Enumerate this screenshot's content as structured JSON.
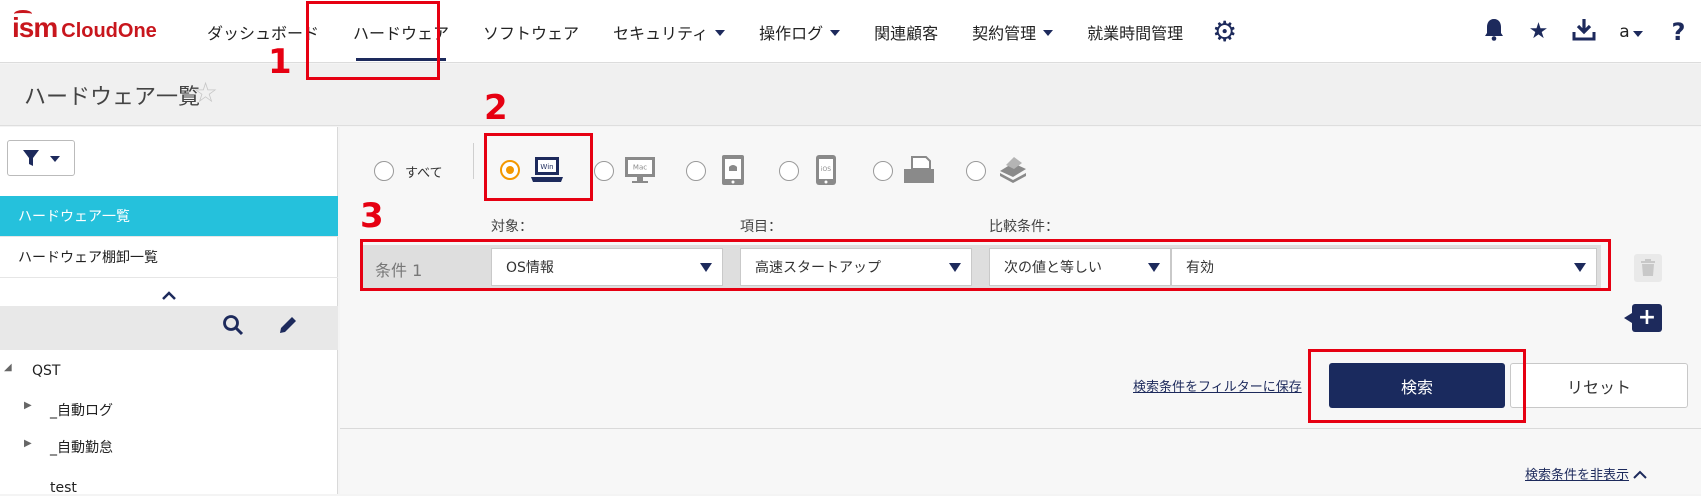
{
  "header": {
    "logo_ism": "ism",
    "logo_cloudone": "CloudOne",
    "nav": [
      {
        "label": "ダッシュボード",
        "dropdown": false
      },
      {
        "label": "ハードウェア",
        "dropdown": false,
        "active": true
      },
      {
        "label": "ソフトウェア",
        "dropdown": false
      },
      {
        "label": "セキュリティ",
        "dropdown": true
      },
      {
        "label": "操作ログ",
        "dropdown": true
      },
      {
        "label": "関連顧客",
        "dropdown": false
      },
      {
        "label": "契約管理",
        "dropdown": true
      },
      {
        "label": "就業時間管理",
        "dropdown": false
      }
    ],
    "gear_icon": "⚙",
    "bell_icon": "🔔",
    "star_icon": "★",
    "download_icon": "⤓",
    "user_label": "a",
    "help_icon": "?"
  },
  "title_bar": {
    "title": "ハードウェア一覧",
    "favorite_icon": "☆"
  },
  "sidebar": {
    "filter_icon": "▼",
    "items": [
      {
        "label": "ハードウェア一覧",
        "active": true
      },
      {
        "label": "ハードウェア棚卸一覧",
        "active": false
      }
    ],
    "collapse_icon": "︿",
    "search_icon": "🔍",
    "edit_icon": "✎",
    "tree": [
      {
        "label": "QST",
        "level": 0
      },
      {
        "label": "_自動ログ",
        "level": 1
      },
      {
        "label": "_自動勤怠",
        "level": 1
      },
      {
        "label": "test",
        "level": 1
      }
    ]
  },
  "device_filter": {
    "all_label": "すべて",
    "selected": "win",
    "devices": [
      "win",
      "mac",
      "android",
      "ios",
      "printer",
      "other"
    ],
    "win_text": "Win",
    "mac_text": "Mac",
    "ios_text": "iOS"
  },
  "condition": {
    "col_target": "対象：",
    "col_item": "項目：",
    "col_compare": "比較条件：",
    "row_name": "条件 1",
    "target_value": "OS情報",
    "item_value": "高速スタートアップ",
    "compare_value": "次の値と等しい",
    "value": "有効"
  },
  "actions": {
    "save_filter_link": "検索条件をフィルターに保存",
    "search_button": "検索",
    "reset_button": "リセット",
    "hide_conditions_link": "検索条件を非表示",
    "add_icon": "+",
    "trash_icon": "🗑"
  },
  "annotations": [
    "1",
    "2",
    "3"
  ],
  "colors": {
    "brand_red": "#c8161d",
    "navy": "#1d2a5c",
    "active_cyan": "#25c1dc",
    "radio_orange": "#f39800",
    "annotation_red": "#e60012"
  }
}
